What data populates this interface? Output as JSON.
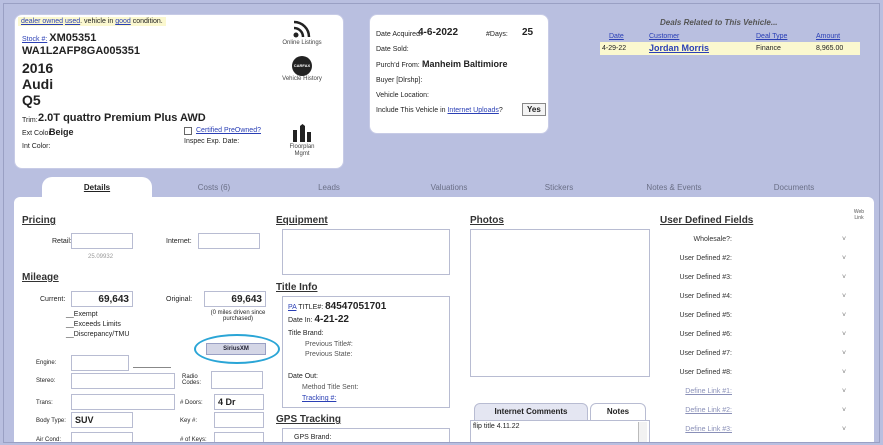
{
  "vehicle": {
    "condition_prefix": "dealer owned",
    "condition_used": "used",
    "condition_mid": ". vehicle in",
    "condition_good": "good",
    "condition_suffix": "condition.",
    "stock_label": "Stock #:",
    "stock": "XM05351",
    "vin": "WA1L2AFP8GA005351",
    "year": "2016",
    "make": "Audi",
    "model": "Q5",
    "trim_label": "Trim:",
    "trim": "2.0T quattro Premium Plus  AWD",
    "ext_color_label": "Ext Color:",
    "ext_color": "Beige",
    "int_color_label": "Int Color:",
    "certified_label": "Certified PreOwned?",
    "inspec_label": "Inspec Exp. Date:"
  },
  "side_icons": [
    {
      "name": "online-listings",
      "label": "Online Listings"
    },
    {
      "name": "carfax",
      "label": "Vehicle History",
      "badge": "CARFAX"
    },
    {
      "name": "floorplan",
      "label": "Floorplan Mgmt"
    }
  ],
  "acquisition": {
    "date_acquired_label": "Date Acquired:",
    "date_acquired": "4-6-2022",
    "days_label": "#Days:",
    "days": "25",
    "date_sold_label": "Date Sold:",
    "purchased_from_label": "Purch'd From:",
    "purchased_from": "Manheim Baltimiore",
    "buyer_label": "Buyer [Dlrshp]:",
    "location_label": "Vehicle Location:",
    "include_prefix": "Include This Vehicle in",
    "include_link": "Internet Uploads",
    "include_suffix": "?",
    "include_value": "Yes"
  },
  "deals": {
    "title": "Deals Related to This Vehicle...",
    "col_date": "Date",
    "col_customer": "Customer",
    "col_type": "Deal Type",
    "col_amount": "Amount",
    "rows": [
      {
        "date": "4-29-22",
        "customer": "Jordan  Morris",
        "type": "Finance",
        "amount": "8,965.00"
      }
    ]
  },
  "tabs": [
    "Details",
    "Costs (6)",
    "Leads",
    "Valuations",
    "Stickers",
    "Notes & Events",
    "Documents"
  ],
  "pricing": {
    "title": "Pricing",
    "retail_label": "Retail:",
    "retail_hint": "25.09932",
    "internet_label": "Internet:"
  },
  "mileage": {
    "title": "Mileage",
    "current_label": "Current:",
    "current": "69,643",
    "original_label": "Original:",
    "original": "69,643",
    "driven_note": "(0 miles driven since purchased)",
    "exempt": "Exempt",
    "exceeds": "Exceeds Limits",
    "discrepancy": "Discrepancy/TMU"
  },
  "specs": {
    "engine_label": "Engine:",
    "stereo_label": "Stereo:",
    "radio_codes_label": "Radio Codes:",
    "trans_label": "Trans:",
    "doors_label": "# Doors:",
    "doors": "4 Dr",
    "body_type_label": "Body Type:",
    "body_type": "SUV",
    "key_label": "Key #:",
    "air_cond_label": "Air Cond:",
    "num_keys_label": "# of Keys:",
    "siriusxm": "SiriusXM"
  },
  "equipment": {
    "title": "Equipment"
  },
  "title_info": {
    "title": "Title Info",
    "pa_label": "PA",
    "title_num_label": "TITLE#:",
    "title_num": "84547051701",
    "date_in_label": "Date In:",
    "date_in": "4-21-22",
    "brand_label": "Title Brand:",
    "prev_title_label": "Previous Title#:",
    "prev_state_label": "Previous State:",
    "date_out_label": "Date Out:",
    "method_label": "Method Title Sent:",
    "tracking_label": "Tracking #:"
  },
  "gps": {
    "title": "GPS Tracking",
    "brand_label": "GPS Brand:"
  },
  "photos": {
    "title": "Photos"
  },
  "comments": {
    "tab_comments": "Internet Comments",
    "tab_notes": "Notes",
    "text": "flip title 4.11.22"
  },
  "user_defined": {
    "title": "User Defined Fields",
    "web_link": "Web Link",
    "fields": [
      "Wholesale?:",
      "User Defined #2:",
      "User Defined #3:",
      "User Defined #4:",
      "User Defined #5:",
      "User Defined #6:",
      "User Defined #7:",
      "User Defined #8:"
    ],
    "links": [
      "Define Link #1:",
      "Define Link #2:",
      "Define Link #3:"
    ]
  },
  "colors": {
    "bg": "#b9bfe0",
    "link": "#2a3fb5",
    "highlight": "#2aa5d6",
    "yellow": "#fbf8cf"
  }
}
